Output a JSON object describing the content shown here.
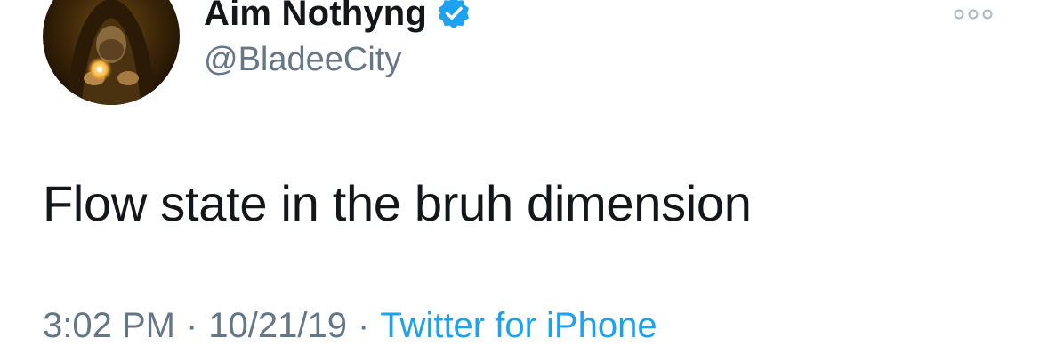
{
  "tweet": {
    "display_name": "Aim Nothyng",
    "verified": true,
    "handle": "@BladeeCity",
    "text": "Flow state in the bruh dimension",
    "time": "3:02 PM",
    "separator": "·",
    "date": "10/21/19",
    "source": "Twitter for iPhone"
  },
  "icons": {
    "verified": "verified-badge-icon",
    "more": "more-options-icon",
    "avatar": "avatar-image"
  },
  "colors": {
    "name": "#14171a",
    "secondary": "#657786",
    "link": "#1da1f2",
    "verified": "#1da1f2"
  }
}
